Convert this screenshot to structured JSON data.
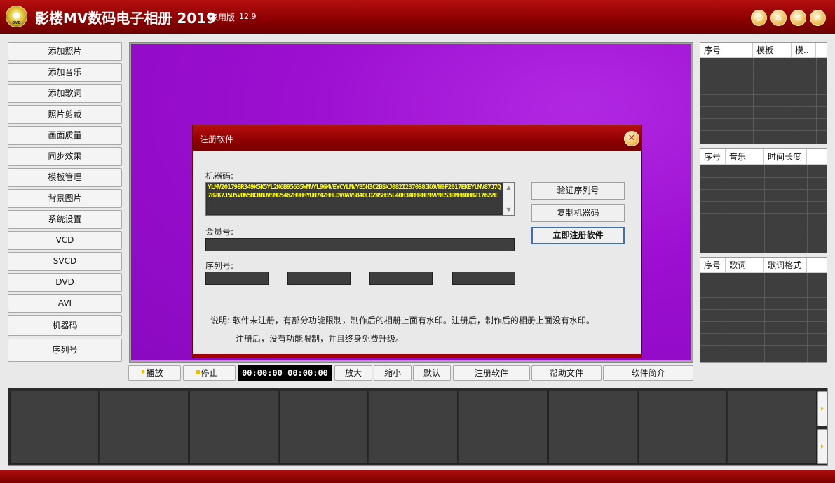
{
  "titlebar": {
    "logo_text": "DVD",
    "title": "影楼MV数码电子相册 2019",
    "edition": "家用版",
    "version": "12.9",
    "buttons": [
      "skin-icon",
      "home-icon",
      "menu-icon",
      "close-icon"
    ]
  },
  "sidebar": {
    "items": [
      "添加照片",
      "添加音乐",
      "添加歌词",
      "照片剪裁",
      "画面质量",
      "同步效果",
      "模板管理",
      "背景图片",
      "系统设置",
      "VCD",
      "SVCD",
      "DVD",
      "AVI",
      "机器码",
      "序列号"
    ]
  },
  "dialog": {
    "title": "注册软件",
    "machine_code_label": "机器码:",
    "machine_code": "YLMV201798R349K5K5YL2K6B95635WMVYL96MVEYCYLMVY85H3C2BSXJ082I2370S85K0VH9F2017EKEYLMV87J7Q782K7J5U5V0W5BCH8UVSMG546ZH9HHYUH74ZHHLDV0AVS840LDZ4SH35L40H34RHRHE9VV9ES39MHB0HB21762ZE",
    "member_label": "会员号:",
    "serial_label": "序列号:",
    "verify_btn": "验证序列号",
    "copy_btn": "复制机器码",
    "register_btn": "立即注册软件",
    "note_line1": "说明: 软件未注册，有部分功能限制，制作后的相册上面有水印。注册后，制作后的相册上面没有水印。",
    "note_line2": "注册后，没有功能限制，并且终身免费升级。"
  },
  "toolbar": {
    "play": "播放",
    "stop": "停止",
    "timecode": "00:00:00  00:00:00",
    "zoom_in": "放大",
    "zoom_out": "缩小",
    "default": "默认",
    "register": "注册软件",
    "help": "帮助文件",
    "about": "软件简介"
  },
  "grids": {
    "templates": {
      "headers": [
        "序号",
        "模板",
        "模.."
      ]
    },
    "music": {
      "headers": [
        "序号",
        "音乐",
        "时间长度"
      ]
    },
    "lyrics": {
      "headers": [
        "序号",
        "歌词",
        "歌词格式"
      ]
    }
  }
}
